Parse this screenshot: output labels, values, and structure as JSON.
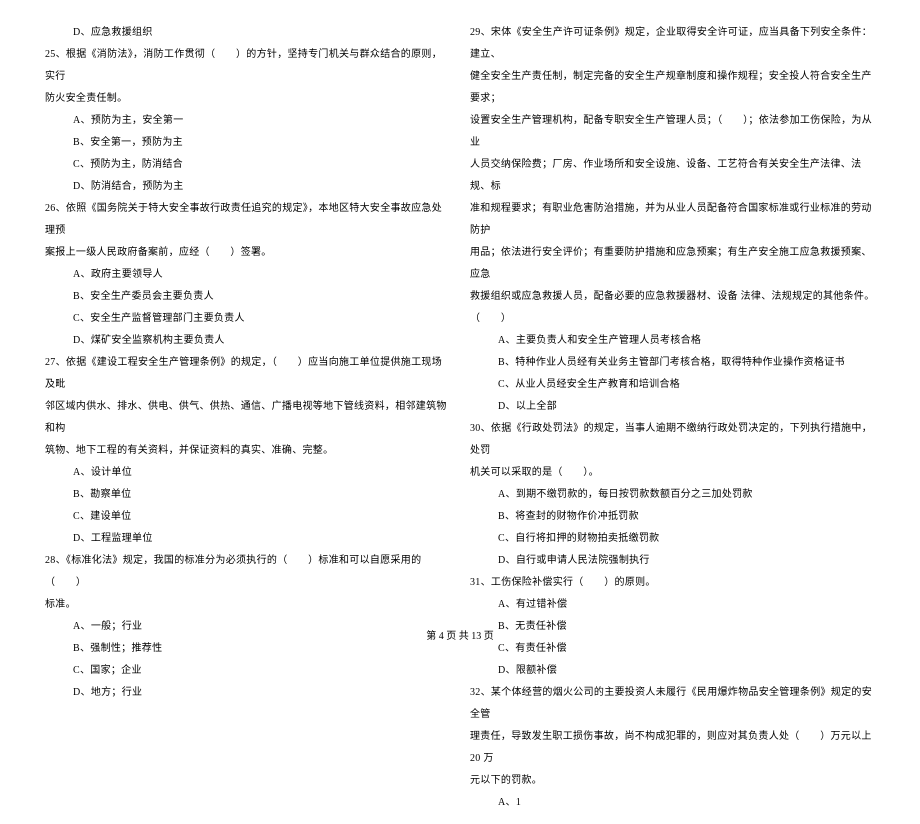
{
  "left": {
    "opt24d": "D、应急救援组织",
    "q25": "25、根据《消防法》，消防工作贯彻（　　）的方针，坚持专门机关与群众结合的原则，实行",
    "q25_cont": "防火安全责任制。",
    "q25a": "A、预防为主，安全第一",
    "q25b": "B、安全第一，预防为主",
    "q25c": "C、预防为主，防消结合",
    "q25d": "D、防消结合，预防为主",
    "q26": "26、依照《国务院关于特大安全事故行政责任追究的规定》，本地区特大安全事故应急处理预",
    "q26_cont": "案报上一级人民政府备案前，应经（　　）签署。",
    "q26a": "A、政府主要领导人",
    "q26b": "B、安全生产委员会主要负责人",
    "q26c": "C、安全生产监督管理部门主要负责人",
    "q26d": "D、煤矿安全监察机构主要负责人",
    "q27": "27、依据《建设工程安全生产管理条例》的规定，（　　）应当向施工单位提供施工现场及毗",
    "q27_cont1": "邻区域内供水、排水、供电、供气、供热、通信、广播电视等地下管线资料，相邻建筑物和构",
    "q27_cont2": "筑物、地下工程的有关资料，并保证资料的真实、准确、完整。",
    "q27a": "A、设计单位",
    "q27b": "B、勘察单位",
    "q27c": "C、建设单位",
    "q27d": "D、工程监理单位",
    "q28": "28、《标准化法》规定，我国的标准分为必须执行的（　　）标准和可以自愿采用的（　　）",
    "q28_cont": "标准。",
    "q28a": "A、一般；行业",
    "q28b": "B、强制性；推荐性",
    "q28c": "C、国家；企业",
    "q28d": "D、地方；行业"
  },
  "right": {
    "q29": "29、宋体《安全生产许可证条例》规定，企业取得安全许可证，应当具备下列安全条件：建立、",
    "q29_cont1": "健全安全生产责任制，制定完备的安全生产规章制度和操作规程；安全投人符合安全生产要求；",
    "q29_cont2": "设置安全生产管理机构，配备专职安全生产管理人员；（　　）；依法参加工伤保险，为从业",
    "q29_cont3": "人员交纳保险费；厂房、作业场所和安全设施、设备、工艺符合有关安全生产法律、法规、标",
    "q29_cont4": "准和规程要求；有职业危害防治措施，并为从业人员配备符合国家标准或行业标准的劳动防护",
    "q29_cont5": "用品；依法进行安全评价；有重要防护措施和应急预案；有生产安全施工应急救援预案、应急",
    "q29_cont6": "救援组织或应急救援人员，配备必要的应急救援器材、设备 法律、法规规定的其他条件。（　　）",
    "q29a": "A、主要负责人和安全生产管理人员考核合格",
    "q29b": "B、特种作业人员经有关业务主管部门考核合格，取得特种作业操作资格证书",
    "q29c": "C、从业人员经安全生产教育和培训合格",
    "q29d": "D、以上全部",
    "q30": "30、依据《行政处罚法》的规定，当事人逾期不缴纳行政处罚决定的，下列执行措施中，处罚",
    "q30_cont": "机关可以采取的是（　　）。",
    "q30a": "A、到期不缴罚款的，每日按罚款数额百分之三加处罚款",
    "q30b": "B、将查封的财物作价冲抵罚款",
    "q30c": "C、自行将扣押的财物拍卖抵缴罚款",
    "q30d": "D、自行或申请人民法院强制执行",
    "q31": "31、工伤保险补偿实行（　　）的原则。",
    "q31a": "A、有过错补偿",
    "q31b": "B、无责任补偿",
    "q31c": "C、有责任补偿",
    "q31d": "D、限额补偿",
    "q32": "32、某个体经营的烟火公司的主要投资人未履行《民用爆炸物品安全管理条例》规定的安全管",
    "q32_cont1": "理责任，导致发生职工损伤事故，尚不构成犯罪的，则应对其负责人处（　　）万元以上 20 万",
    "q32_cont2": "元以下的罚款。",
    "q32a": "A、1"
  },
  "footer": "第 4 页 共 13 页"
}
